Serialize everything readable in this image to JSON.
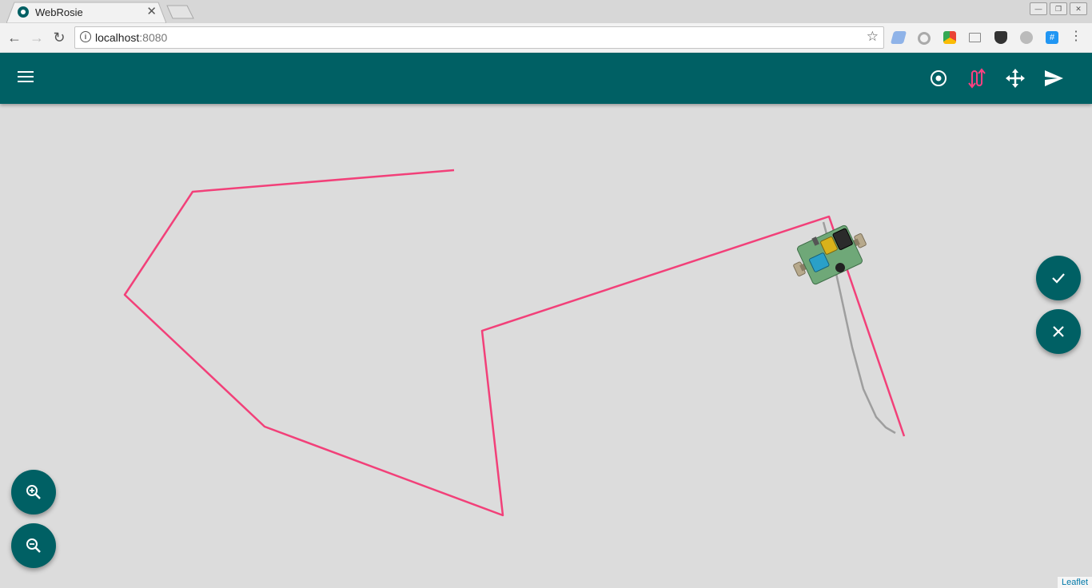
{
  "browser": {
    "tab_title": "WebRosie",
    "tab_close": "✕",
    "url_host": "localhost",
    "url_port": ":8080"
  },
  "window_controls": [
    "—",
    "❐",
    "✕"
  ],
  "appbar": {
    "icons": [
      "target-icon",
      "route-icon",
      "move-icon",
      "send-icon"
    ],
    "accent": "#ff4081",
    "bg": "#006064"
  },
  "map": {
    "path_color": "#f24079",
    "trail_color": "#9e9e9e",
    "attribution": "Leaflet"
  },
  "fabs": {
    "confirm": "check-icon",
    "cancel": "close-icon",
    "zoom_in": "zoom-in-icon",
    "zoom_out": "zoom-out-icon"
  }
}
